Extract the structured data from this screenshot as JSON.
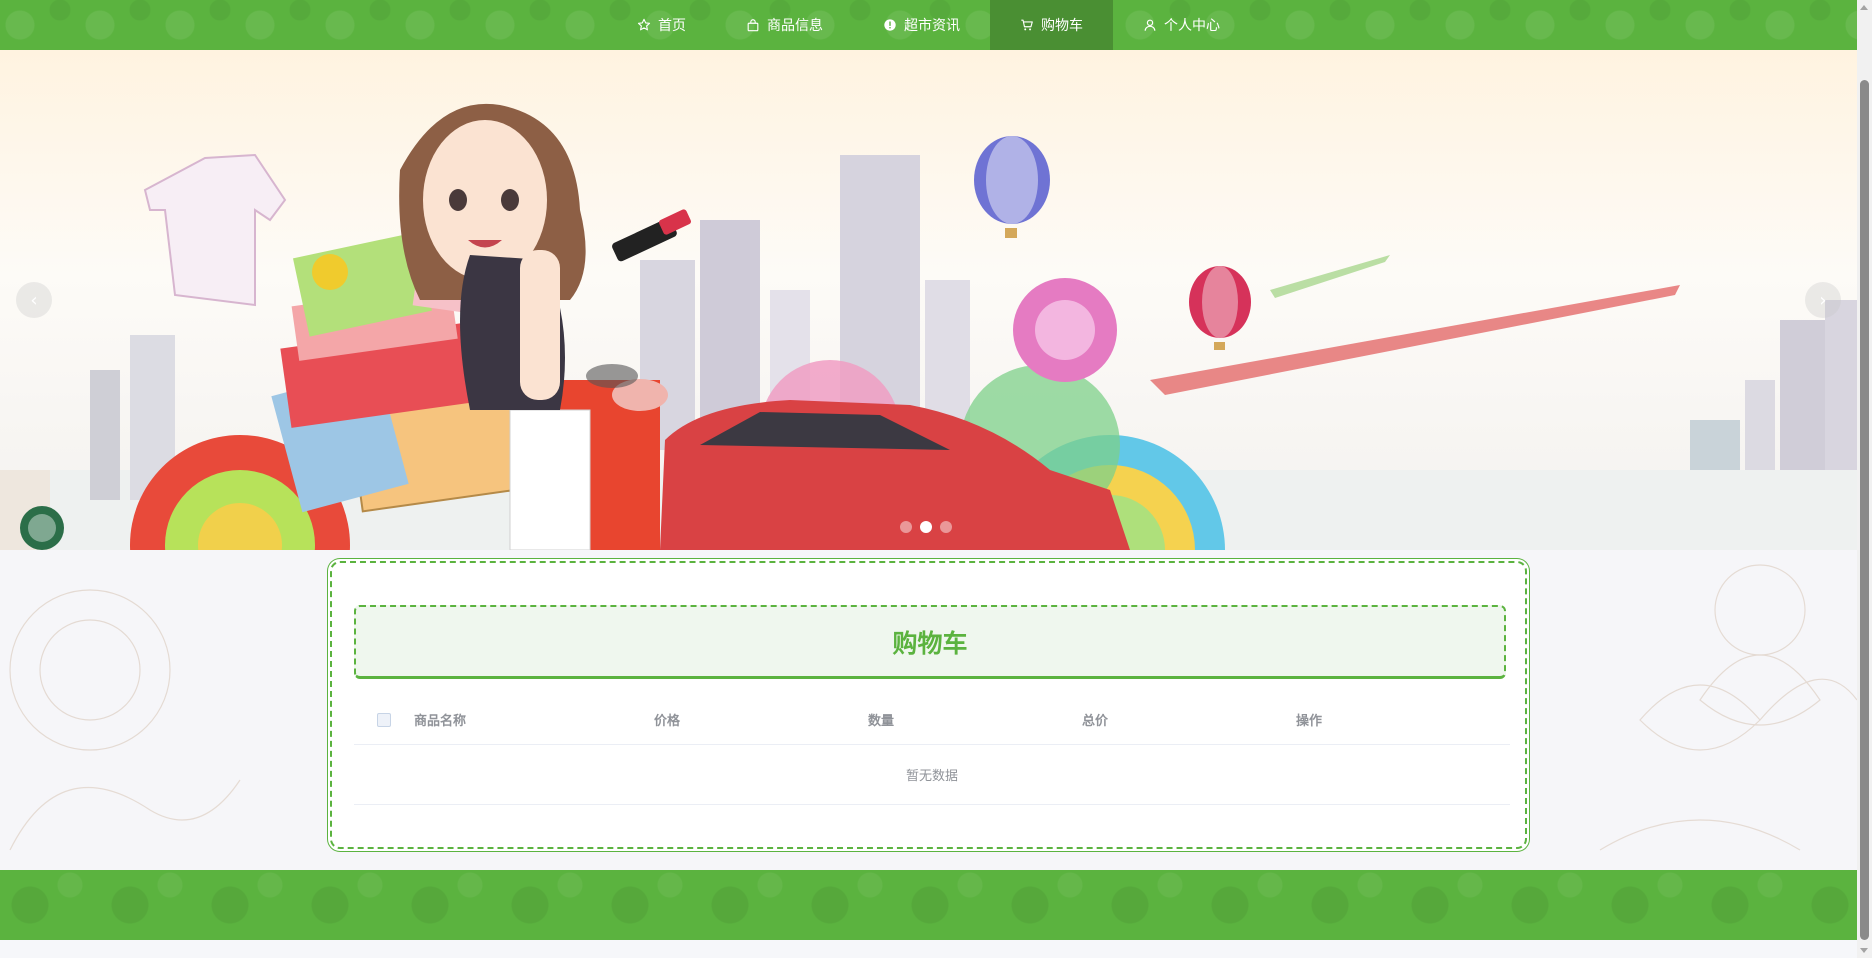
{
  "nav": {
    "items": [
      {
        "label": "首页",
        "icon": "star-icon"
      },
      {
        "label": "商品信息",
        "icon": "shopping-bag-icon"
      },
      {
        "label": "超市资讯",
        "icon": "info-circle-icon"
      },
      {
        "label": "购物车",
        "icon": "cart-icon",
        "active": true
      },
      {
        "label": "个人中心",
        "icon": "user-icon"
      }
    ]
  },
  "banner": {
    "prev_arrow": "‹",
    "next_arrow": "›",
    "slide_count": 3,
    "active_slide": 2
  },
  "cart": {
    "title": "购物车",
    "columns": [
      "商品名称",
      "价格",
      "数量",
      "总价",
      "操作"
    ],
    "empty_text": "暂无数据"
  },
  "colors": {
    "primary": "#5bb33f",
    "primary_dark": "#4a8f33",
    "title_bg": "#eff7ee"
  }
}
